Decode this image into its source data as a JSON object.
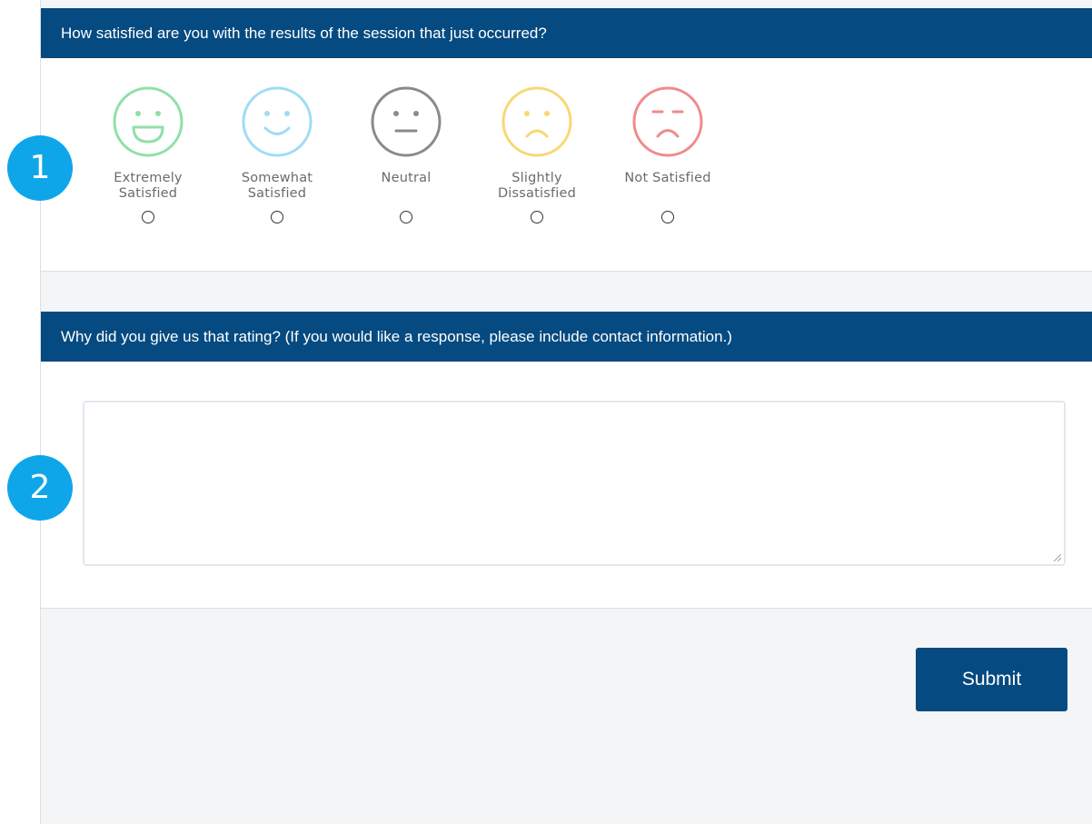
{
  "question1": {
    "title": "How satisfied are you with the results of the session that just occurred?",
    "options": [
      {
        "line1": "Extremely",
        "line2": "Satisfied",
        "icon": "very-happy-face-icon",
        "color": "#8fe0a7"
      },
      {
        "line1": "Somewhat",
        "line2": "Satisfied",
        "icon": "happy-face-icon",
        "color": "#9fdcf5"
      },
      {
        "line1": "Neutral",
        "line2": "",
        "icon": "neutral-face-icon",
        "color": "#8a8a8a"
      },
      {
        "line1": "Slightly",
        "line2": "Dissatisfied",
        "icon": "sad-face-icon",
        "color": "#f7d873"
      },
      {
        "line1": "Not Satisfied",
        "line2": "",
        "icon": "very-sad-face-icon",
        "color": "#f28a8a"
      }
    ]
  },
  "question2": {
    "title": "Why did you give us that rating?  (If you would like a response, please include contact information.)",
    "value": ""
  },
  "submit": {
    "label": "Submit"
  },
  "steps": {
    "one": "1",
    "two": "2"
  },
  "colors": {
    "header": "#054a80",
    "badge": "#0ea6e9",
    "background": "#f4f5f6"
  }
}
